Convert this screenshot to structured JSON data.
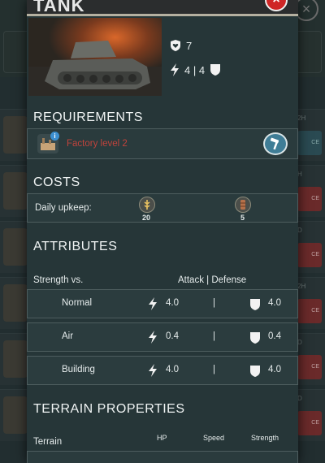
{
  "modal": {
    "title": "TANK",
    "close_label": "×",
    "stats": {
      "hitpoints": "7",
      "attack_defense": "4 | 4"
    }
  },
  "requirements": {
    "title": "REQUIREMENTS",
    "item": "Factory level 2",
    "badge": "i",
    "action_icon": "hammer-icon",
    "text_color": "#c0433c"
  },
  "costs": {
    "title": "COSTS",
    "label": "Daily upkeep:",
    "resources": [
      {
        "icon": "grain-icon",
        "amount": "20"
      },
      {
        "icon": "barrel-icon",
        "amount": "5"
      }
    ]
  },
  "attributes": {
    "title": "ATTRIBUTES",
    "strength_label": "Strength vs.",
    "header": "Attack | Defense",
    "rows": [
      {
        "name": "Normal",
        "attack": "4.0",
        "sep": "|",
        "defense": "4.0"
      },
      {
        "name": "Air",
        "attack": "0.4",
        "sep": "|",
        "defense": "0.4"
      },
      {
        "name": "Building",
        "attack": "4.0",
        "sep": "|",
        "defense": "4.0"
      }
    ]
  },
  "terrain": {
    "title": "TERRAIN PROPERTIES",
    "label": "Terrain",
    "cols": [
      "HP",
      "Speed",
      "Strength"
    ]
  }
}
